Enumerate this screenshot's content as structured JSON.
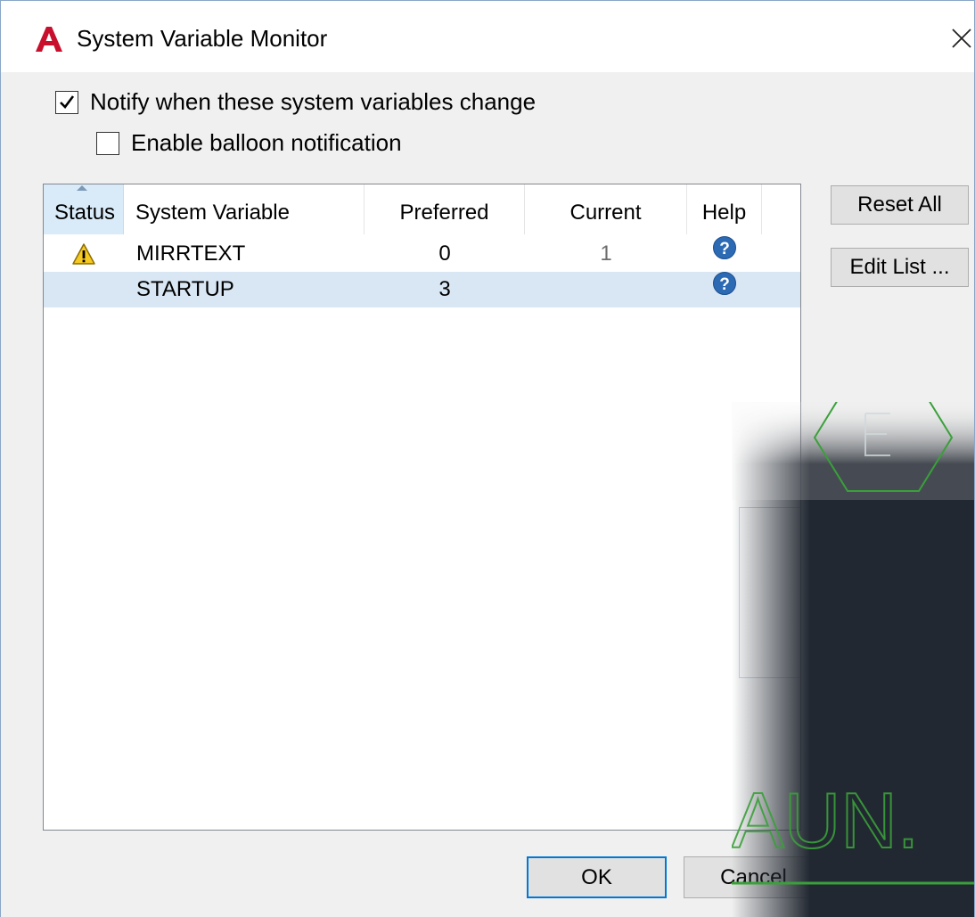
{
  "window": {
    "title": "System Variable Monitor",
    "close_glyph": "✕",
    "app_icon": "autocad-logo-icon",
    "accent_color": "#c8102e"
  },
  "options": {
    "notify_label": "Notify when these system variables change",
    "notify_checked": true,
    "balloon_label": "Enable balloon notification",
    "balloon_checked": false
  },
  "table": {
    "columns": [
      "Status",
      "System Variable",
      "Preferred",
      "Current",
      "Help"
    ],
    "sorted_column": "Status",
    "rows": [
      {
        "status_icon": "warning-icon",
        "variable": "MIRRTEXT",
        "preferred": "0",
        "current": "1",
        "help_icon": "help-icon"
      },
      {
        "status_icon": "",
        "variable": "STARTUP",
        "preferred": "3",
        "current": "",
        "help_icon": "help-icon"
      }
    ]
  },
  "side_buttons": {
    "reset_all": "Reset All",
    "edit_list": "Edit List ..."
  },
  "footer": {
    "ok": "OK",
    "cancel": "Cancel"
  },
  "background_app": {
    "hex_letter": "E",
    "text": "AUN.",
    "line_color": "#3aa03a",
    "bg_color": "#222831"
  }
}
